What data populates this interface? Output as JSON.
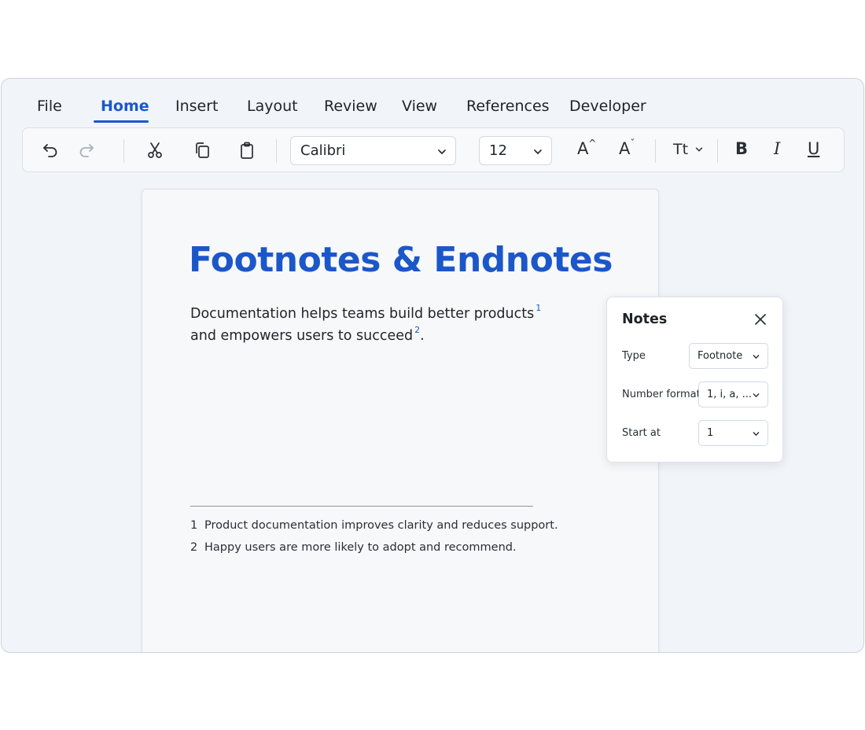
{
  "menu": {
    "tabs": [
      {
        "label": "File"
      },
      {
        "label": "Home",
        "active": true
      },
      {
        "label": "Insert"
      },
      {
        "label": "Layout"
      },
      {
        "label": "Review"
      },
      {
        "label": "View"
      },
      {
        "label": "References"
      },
      {
        "label": "Developer"
      }
    ]
  },
  "toolbar": {
    "font_name": "Calibri",
    "font_size": "12",
    "grow_font_glyph": "A",
    "grow_font_mark": "^",
    "shrink_font_glyph": "A",
    "shrink_font_mark": "ˇ",
    "text_case_glyph": "Tt",
    "bold_glyph": "B",
    "italic_glyph": "I",
    "underline_glyph": "U",
    "icons": [
      "undo-icon",
      "redo-icon",
      "cut-icon",
      "copy-icon",
      "paste-icon",
      "chevron-down-icon"
    ]
  },
  "document": {
    "title": "Footnotes & Endnotes",
    "body_line1": "Documentation helps teams build better products",
    "ref1": "1",
    "body_line2": "and empowers users to succeed",
    "ref2": "2",
    "body_line2_end": ".",
    "footnotes": [
      {
        "num": "1",
        "text": "Product documentation improves clarity and reduces support."
      },
      {
        "num": "2",
        "text": "Happy users are more likely to adopt and recommend."
      }
    ]
  },
  "notes_panel": {
    "title": "Notes",
    "type_label": "Type",
    "type_value": "Footnote",
    "number_format_label": "Number format",
    "number_format_value": "1, i, a, ...",
    "start_at_label": "Start at",
    "start_at_value": "1"
  },
  "colors": {
    "accent": "#1c57c9",
    "window_bg": "#f1f4f8",
    "page_bg": "#f7f8fa"
  }
}
